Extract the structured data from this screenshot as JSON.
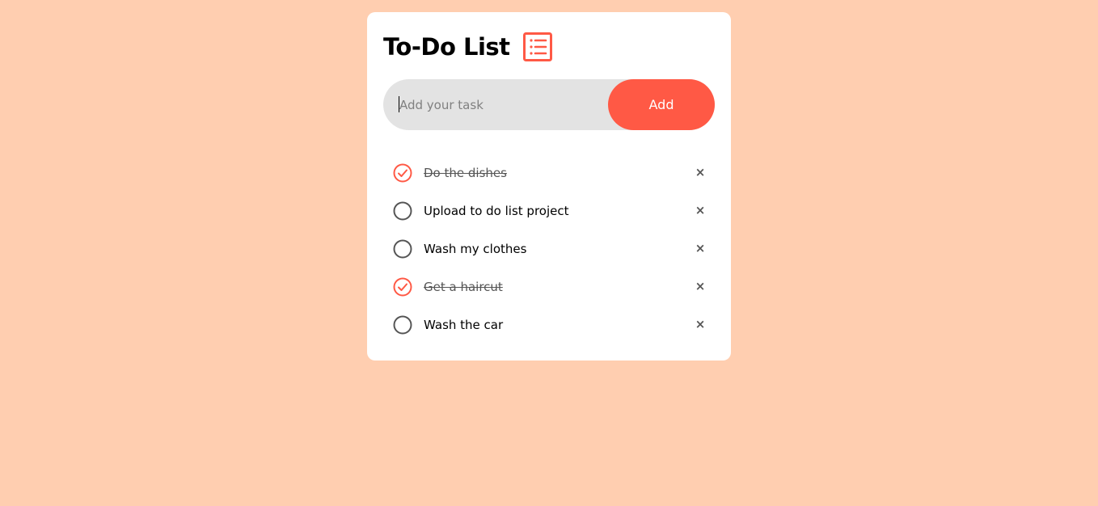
{
  "app": {
    "title": "To-Do List",
    "icon": "checklist-icon",
    "accent_color": "#ff5945",
    "background_color": "#ffceb0"
  },
  "input": {
    "value": "",
    "placeholder": "Add your task"
  },
  "add_button": {
    "label": "Add"
  },
  "tasks": [
    {
      "label": "Do the dishes",
      "done": true,
      "remove_label": "×"
    },
    {
      "label": "Upload to do list project",
      "done": false,
      "remove_label": "×"
    },
    {
      "label": "Wash my clothes",
      "done": false,
      "remove_label": "×"
    },
    {
      "label": "Get a haircut",
      "done": true,
      "remove_label": "×"
    },
    {
      "label": "Wash the car",
      "done": false,
      "remove_label": "×"
    }
  ]
}
